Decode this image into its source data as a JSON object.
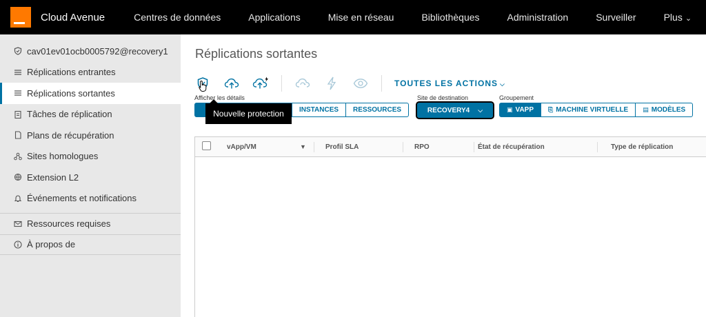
{
  "topnav": {
    "brand": "Cloud Avenue",
    "items": [
      "Centres de données",
      "Applications",
      "Mise en réseau",
      "Bibliothèques",
      "Administration",
      "Surveiller"
    ],
    "more": "Plus"
  },
  "sidebar": {
    "items": [
      {
        "label": "cav01ev01ocb0005792@recovery1",
        "icon": "shield-icon"
      },
      {
        "label": "Réplications entrantes",
        "icon": "list-icon"
      },
      {
        "label": "Réplications sortantes",
        "icon": "list-icon",
        "active": true
      },
      {
        "label": "Tâches de réplication",
        "icon": "clipboard-icon"
      },
      {
        "label": "Plans de récupération",
        "icon": "document-icon"
      },
      {
        "label": "Sites homologues",
        "icon": "network-icon"
      },
      {
        "label": "Extension L2",
        "icon": "network-icon"
      },
      {
        "label": "Événements et notifications",
        "icon": "bell-icon"
      }
    ],
    "footer_items": [
      {
        "label": "Ressources requises",
        "icon": "envelope-icon"
      },
      {
        "label": "À propos de",
        "icon": "info-icon"
      }
    ]
  },
  "main": {
    "title": "Réplications sortantes",
    "all_actions": "TOUTES LES ACTIONS",
    "tooltip": "Nouvelle protection",
    "details": {
      "label": "Afficher les détails",
      "options": [
        "INSTANCES",
        "RESSOURCES"
      ]
    },
    "destination": {
      "label": "Site de destination",
      "value": "RECOVERY4"
    },
    "grouping": {
      "label": "Groupement",
      "options": [
        "VAPP",
        "MACHINE VIRTUELLE",
        "MODÈLES"
      ],
      "selected": "VAPP"
    },
    "grid": {
      "columns": [
        "vApp/VM",
        "Profil SLA",
        "RPO",
        "État de récupération",
        "Type de réplication"
      ]
    }
  },
  "colors": {
    "accent": "#0072a3",
    "brand": "#ff7900",
    "nav_bg": "#000000"
  }
}
